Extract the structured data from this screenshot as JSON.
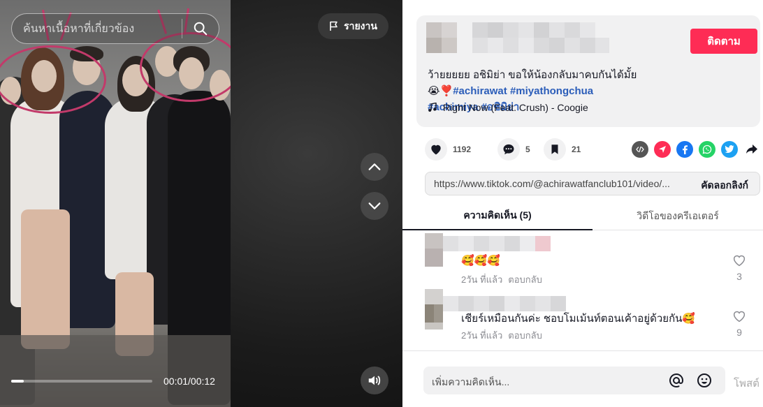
{
  "video": {
    "search_placeholder": "ค้นหาเนื้อหาที่เกี่ยวข้อง",
    "report_label": "รายงาน",
    "time": "00:01/00:12",
    "progress": 0.09
  },
  "post": {
    "follow_label": "ติดตาม",
    "caption_text": "ว้ายยยยย อชิมิย่า ขอให้น้องกลับมาคบกันได้มั้ย😭❣️",
    "hashtags": [
      "#achirawat",
      "#miyathongchua",
      "#achimiya",
      "#อชิมิย่า"
    ],
    "music": "Right Now (Feat. Crush) - Coogie"
  },
  "actions": {
    "likes": "1192",
    "comments": "5",
    "saves": "21"
  },
  "share_icons": [
    "embed-icon",
    "send-icon",
    "facebook-icon",
    "whatsapp-icon",
    "twitter-icon",
    "share-arrow-icon"
  ],
  "link": {
    "url": "https://www.tiktok.com/@achirawatfanclub101/video/...",
    "copy_label": "คัดลอกลิงก์"
  },
  "tabs": {
    "comments": "ความคิดเห็น (5)",
    "creator_videos": "วิดีโอของครีเอเตอร์"
  },
  "comments": [
    {
      "text": "🥰🥰🥰",
      "time": "2วัน ที่แล้ว",
      "reply": "ตอบกลับ",
      "likes": "3"
    },
    {
      "text": "เชียร์เหมือนกันค่ะ ชอบโมเม้นท์ตอนเค้าอยู่ด้วยกัน🥰",
      "time": "2วัน ที่แล้ว",
      "reply": "ตอบกลับ",
      "likes": "9"
    }
  ],
  "composer": {
    "placeholder": "เพิ่มความคิดเห็น...",
    "post_label": "โพสต์"
  },
  "colors": {
    "accent": "#fe2c55",
    "hashtag": "#2b5db9"
  }
}
